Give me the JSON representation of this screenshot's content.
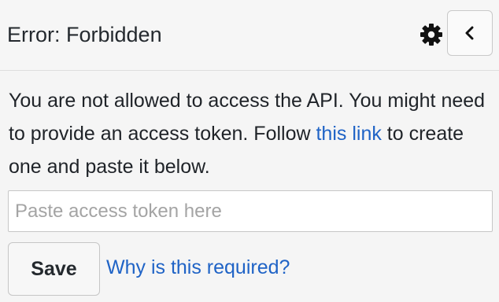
{
  "header": {
    "title": "Error: Forbidden",
    "settings_icon": "gear-icon",
    "collapse_icon": "chevron-left-icon"
  },
  "message": {
    "text_before_link": "You are not allowed to access the API. You might need to provide an access token. Follow ",
    "link_text": "this link",
    "text_after_link": " to create one and paste it below."
  },
  "token_input": {
    "value": "",
    "placeholder": "Paste access token here"
  },
  "actions": {
    "save_label": "Save",
    "why_link": "Why is this required?"
  },
  "colors": {
    "link": "#1f63c6",
    "background": "#f5f5f5",
    "text": "#24292e"
  }
}
